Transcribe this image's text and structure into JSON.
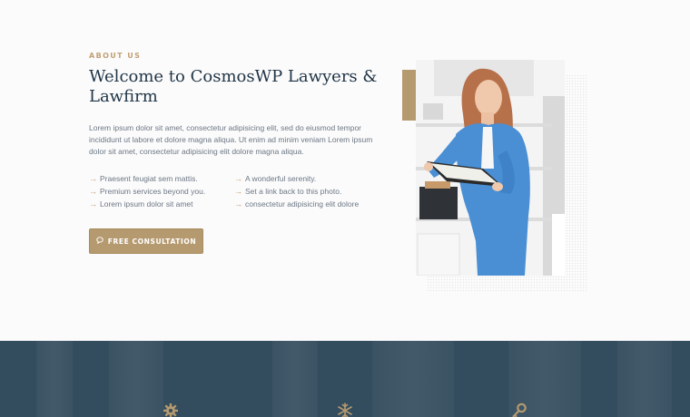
{
  "about": {
    "eyebrow": "ABOUT US",
    "title": "Welcome to CosmosWP Lawyers & Lawfirm",
    "description": "Lorem ipsum dolor sit amet, consectetur adipisicing elit, sed do eiusmod tempor incididunt ut labore et dolore magna aliqua. Ut enim ad minim veniam Lorem ipsum dolor sit amet, consectetur adipisicing elit dolore magna aliqua.",
    "features_left": [
      "Praesent feugiat sem mattis.",
      "Premium services beyond you.",
      "Lorem ipsum dolor sit amet"
    ],
    "features_right": [
      "A wonderful serenity.",
      "Set a link back to this photo.",
      "consectetur adipisicing elit dolore"
    ],
    "cta_label": "FREE CONSULTATION",
    "cta_icon": "chat-bubble-icon"
  },
  "services_icons": [
    "gear-icon",
    "snowflake-icon",
    "key-icon"
  ],
  "colors": {
    "accent": "#b59a70",
    "heading": "#1f3446",
    "dark_band": "#344d5e"
  }
}
